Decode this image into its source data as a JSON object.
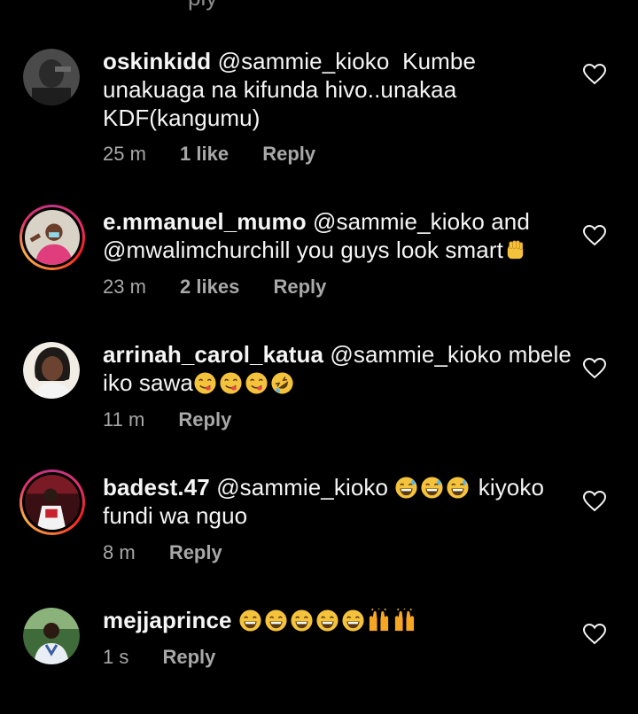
{
  "top_cut_text": "ply",
  "comments": [
    {
      "username": "oskinkidd",
      "mention": "@sammie_kioko",
      "body": "Kumbe unakuaga na kifunda hivo..unakaa KDF(kangumu)",
      "time": "25 m",
      "likes": "1 like",
      "reply": "Reply"
    },
    {
      "username": "e.mmanuel_mumo",
      "mention": "@sammie_kioko",
      "body": "and @mwalimchurchill  you guys look smart",
      "body_emojis": [
        "fist-emoji"
      ],
      "time": "23 m",
      "likes": "2 likes",
      "reply": "Reply"
    },
    {
      "username": "arrinah_carol_katua",
      "mention": "@sammie_kioko",
      "body": "mbele iko sawa",
      "body_emojis": [
        "yum-emoji",
        "yum-emoji",
        "yum-emoji",
        "rofl-emoji"
      ],
      "time": "11 m",
      "reply": "Reply"
    },
    {
      "username": "badest.47",
      "mention": "@sammie_kioko",
      "body_emojis": [
        "grin-sweat-emoji",
        "grin-sweat-emoji",
        "grin-sweat-emoji"
      ],
      "body": "kiyoko fundi wa nguo",
      "time": "8 m",
      "reply": "Reply"
    },
    {
      "username": "mejjaprince",
      "body_emojis": [
        "laugh-emoji",
        "laugh-emoji",
        "laugh-emoji",
        "laugh-emoji",
        "laugh-emoji",
        "raised-hands-emoji",
        "raised-hands-emoji"
      ],
      "time": "1 s",
      "reply": "Reply"
    }
  ],
  "colors": {
    "background": "#000000",
    "text": "#f5f5f5",
    "meta": "#a8a8a8",
    "emoji_yellow": "#f5c33b"
  }
}
